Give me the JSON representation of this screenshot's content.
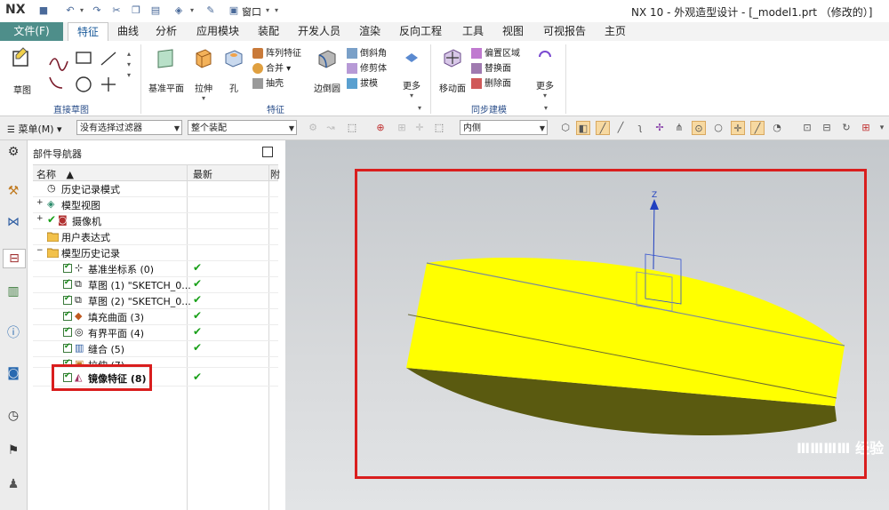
{
  "app": {
    "logo": "NX",
    "window_menu": "窗口",
    "title": "NX 10 - 外观造型设计 - [_model1.prt （修改的）]"
  },
  "tabs": [
    "文件(F)",
    "特征",
    "曲线",
    "分析",
    "应用模块",
    "装配",
    "开发人员",
    "渲染",
    "反向工程",
    "工具",
    "视图",
    "可视报告",
    "主页"
  ],
  "ribbon": {
    "sketch": "草图",
    "direct_sketch_group": "直接草图",
    "datum_plane": "基准平面",
    "extrude": "拉伸",
    "hole": "孔",
    "pattern_feature": "阵列特征",
    "unite": "合并",
    "shell": "抽壳",
    "feature_group": "特征",
    "edge_blend": "边倒圆",
    "chamfer": "倒斜角",
    "trim_body": "修剪体",
    "draft": "拔模",
    "more": "更多",
    "move_face": "移动面",
    "offset_region": "偏置区域",
    "replace_face": "替换面",
    "delete_face": "删除面",
    "sync_group": "同步建模",
    "more2": "更多"
  },
  "selection_bar": {
    "menu": "菜单(M)",
    "filter": "没有选择过滤器",
    "scope": "整个装配",
    "snap": "内侧"
  },
  "navigator": {
    "title": "部件导航器",
    "col_name": "名称",
    "col_latest": "最新",
    "col_extra": "附",
    "rows": [
      {
        "label": "历史记录模式",
        "latest": ""
      },
      {
        "label": "模型视图",
        "latest": ""
      },
      {
        "label": "摄像机",
        "latest": ""
      },
      {
        "label": "用户表达式",
        "latest": ""
      },
      {
        "label": "模型历史记录",
        "latest": ""
      },
      {
        "label": "基准坐标系 (0)",
        "latest": "✔"
      },
      {
        "label": "草图 (1) \"SKETCH_0...",
        "latest": "✔"
      },
      {
        "label": "草图 (2) \"SKETCH_0...",
        "latest": "✔"
      },
      {
        "label": "填充曲面 (3)",
        "latest": "✔"
      },
      {
        "label": "有界平面 (4)",
        "latest": "✔"
      },
      {
        "label": "缝合 (5)",
        "latest": "✔"
      },
      {
        "label": "拉伸 (7)",
        "latest": "✔"
      },
      {
        "label": "镜像特征 (8)",
        "latest": "✔"
      }
    ]
  },
  "viewport": {
    "axis_z": "Z",
    "watermark": "ⅢⅢⅢⅢ 经验",
    "model_color": "#ffff00"
  },
  "colors": {
    "accent": "#4e8e8a",
    "highlight": "#d91e1e"
  }
}
